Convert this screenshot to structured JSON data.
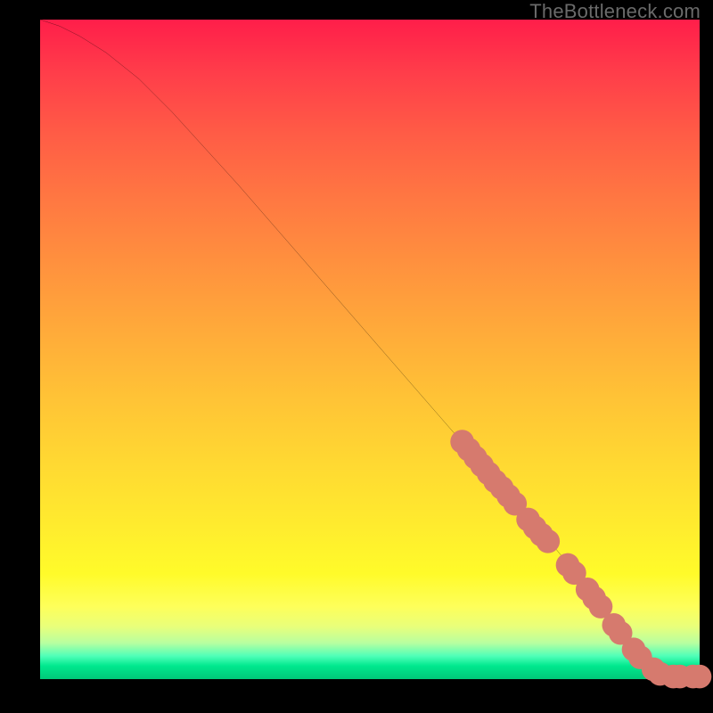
{
  "watermark": "TheBottleneck.com",
  "chart_data": {
    "type": "line",
    "title": "",
    "xlabel": "",
    "ylabel": "",
    "xlim": [
      0,
      100
    ],
    "ylim": [
      0,
      100
    ],
    "series": [
      {
        "name": "curve",
        "x": [
          0,
          3,
          6,
          10,
          15,
          20,
          30,
          40,
          50,
          60,
          70,
          78,
          82,
          85,
          88,
          90,
          92,
          95,
          100
        ],
        "y": [
          100,
          99,
          97.5,
          95,
          91,
          86,
          75,
          63.5,
          52,
          40.5,
          29,
          20,
          15,
          11,
          7,
          4.5,
          2.2,
          0.4,
          0.4
        ]
      }
    ],
    "markers": [
      {
        "name": "dots",
        "color": "#d67a6e",
        "r": 1.8,
        "points": [
          {
            "x": 64,
            "y": 36
          },
          {
            "x": 65,
            "y": 34.8
          },
          {
            "x": 66,
            "y": 33.6
          },
          {
            "x": 67,
            "y": 32.4
          },
          {
            "x": 68,
            "y": 31.2
          },
          {
            "x": 69,
            "y": 30.0
          },
          {
            "x": 70,
            "y": 29.0
          },
          {
            "x": 71,
            "y": 27.8
          },
          {
            "x": 72,
            "y": 26.6
          },
          {
            "x": 74,
            "y": 24.2
          },
          {
            "x": 75,
            "y": 23.0
          },
          {
            "x": 76,
            "y": 21.9
          },
          {
            "x": 77,
            "y": 20.9
          },
          {
            "x": 80,
            "y": 17.3
          },
          {
            "x": 81,
            "y": 16.1
          },
          {
            "x": 83,
            "y": 13.6
          },
          {
            "x": 84,
            "y": 12.3
          },
          {
            "x": 85,
            "y": 11.0
          },
          {
            "x": 87,
            "y": 8.2
          },
          {
            "x": 88,
            "y": 7.0
          },
          {
            "x": 90,
            "y": 4.5
          },
          {
            "x": 91,
            "y": 3.3
          },
          {
            "x": 93,
            "y": 1.5
          },
          {
            "x": 94,
            "y": 0.8
          },
          {
            "x": 96,
            "y": 0.4
          },
          {
            "x": 97,
            "y": 0.4
          },
          {
            "x": 99,
            "y": 0.4
          },
          {
            "x": 100,
            "y": 0.4
          }
        ]
      }
    ]
  }
}
